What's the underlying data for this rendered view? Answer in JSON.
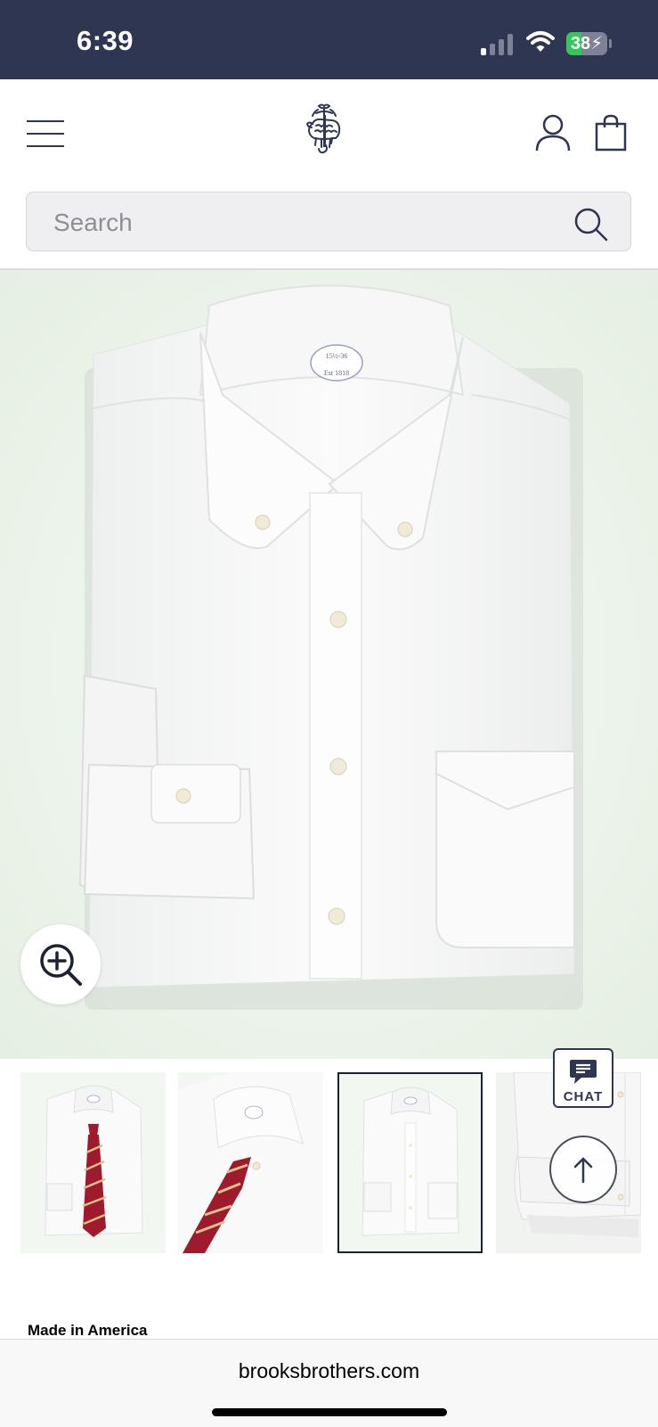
{
  "status_bar": {
    "time": "6:39",
    "battery_percent": "38",
    "battery_level": 0.38,
    "signal_bars_active": 1,
    "charging": true
  },
  "header": {
    "menu_icon": "hamburger-menu-icon",
    "logo": "brooks-brothers-golden-fleece-logo",
    "account_icon": "account-icon",
    "bag_icon": "shopping-bag-icon"
  },
  "search": {
    "placeholder": "Search",
    "value": "",
    "icon": "search-icon"
  },
  "product": {
    "main_image": "white-oxford-button-down-shirt-folded",
    "collar_label_lines": [
      "15½-36",
      "Est 1818"
    ],
    "zoom_icon": "zoom-in-icon",
    "thumbnails": [
      {
        "image": "shirt-with-red-striped-tie",
        "selected": false
      },
      {
        "image": "shirt-collar-closeup-with-tie",
        "selected": false
      },
      {
        "image": "shirt-folded-front",
        "selected": true
      },
      {
        "image": "shirt-side-cuff-detail",
        "selected": false
      }
    ],
    "origin_label": "Made in America"
  },
  "chat": {
    "label": "CHAT",
    "icon": "chat-bubble-icon"
  },
  "back_to_top": {
    "icon": "arrow-up-icon"
  },
  "browser": {
    "url": "brooksbrothers.com"
  },
  "colors": {
    "navy": "#2f3652",
    "text": "#1d2233",
    "search_bg": "#efeff2",
    "hero_bg": "#eef5ec",
    "tie_red": "#9e1a2c"
  }
}
